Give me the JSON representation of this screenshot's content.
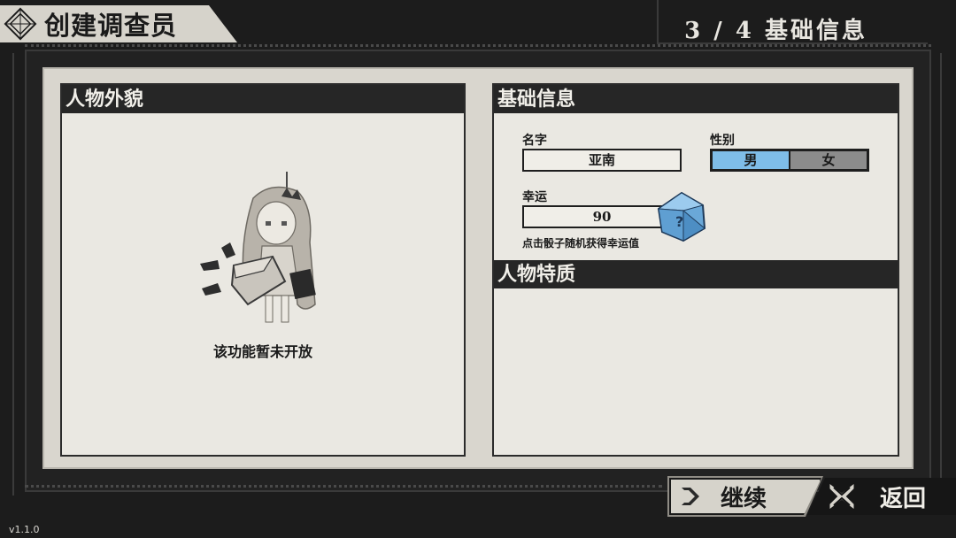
{
  "header": {
    "title": "创建调查员",
    "step": "3 / 4 基础信息"
  },
  "appearance": {
    "heading": "人物外貌",
    "unavailable": "该功能暂未开放"
  },
  "basic_info": {
    "heading": "基础信息",
    "name_label": "名字",
    "name_value": "亚南",
    "gender_label": "性别",
    "gender_options": [
      "男",
      "女"
    ],
    "gender_selected": "男",
    "luck_label": "幸运",
    "luck_value": "90",
    "luck_hint": "点击骰子随机获得幸运值"
  },
  "traits": {
    "heading": "人物特质"
  },
  "buttons": {
    "continue": "继续",
    "back": "返回"
  },
  "version": "v1.1.0",
  "colors": {
    "accent_selected": "#7fbde8",
    "panel_bg": "#eae8e2",
    "header_bg": "#262626"
  }
}
